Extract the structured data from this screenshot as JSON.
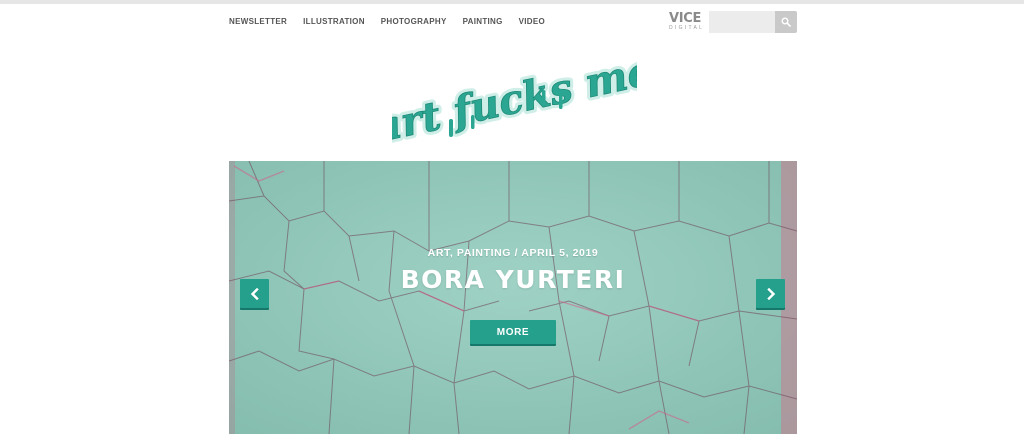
{
  "nav": {
    "items": [
      {
        "label": "NEWSLETTER"
      },
      {
        "label": "ILLUSTRATION"
      },
      {
        "label": "PHOTOGRAPHY"
      },
      {
        "label": "PAINTING"
      },
      {
        "label": "VIDEO"
      }
    ]
  },
  "brand": {
    "vice_text": "VICE",
    "vice_sub": "DIGITAL",
    "logo_text": "art fucks me",
    "logo_color": "#2aa692"
  },
  "search": {
    "placeholder": "",
    "value": "",
    "icon": "search-icon"
  },
  "hero": {
    "categories": "ART, PAINTING",
    "separator": "/",
    "date": "APRIL 5, 2019",
    "title": "BORA YURTERI",
    "more_label": "MORE",
    "prev_icon": "chevron-left-icon",
    "next_icon": "chevron-right-icon",
    "accent": "#24a08c"
  }
}
